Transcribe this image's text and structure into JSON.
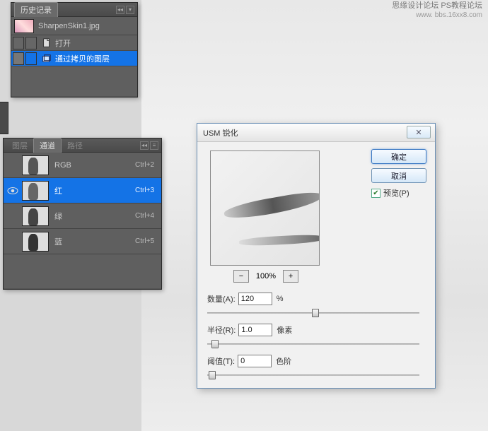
{
  "watermark": {
    "line1": "思缘设计论坛  PS教程论坛",
    "line2": "www.  bbs.16xx8.com"
  },
  "history": {
    "tab": "历史记录",
    "filename": "SharpenSkin1.jpg",
    "items": [
      {
        "icon": "open",
        "label": "打开"
      },
      {
        "icon": "layer",
        "label": "通过拷贝的图层",
        "selected": true
      }
    ]
  },
  "channels": {
    "tabs": [
      "图层",
      "通道",
      "路径"
    ],
    "active_tab": 1,
    "rows": [
      {
        "name": "RGB",
        "key": "Ctrl+2",
        "eye": false
      },
      {
        "name": "红",
        "key": "Ctrl+3",
        "eye": true,
        "selected": true
      },
      {
        "name": "绿",
        "key": "Ctrl+4",
        "eye": false
      },
      {
        "name": "蓝",
        "key": "Ctrl+5",
        "eye": false
      }
    ]
  },
  "dialog": {
    "title": "USM 锐化",
    "ok": "确定",
    "cancel": "取消",
    "preview_label": "预览(P)",
    "preview_checked": true,
    "zoom": "100%",
    "zoom_out_glyph": "−",
    "zoom_in_glyph": "+",
    "amount_label": "数量(A):",
    "amount_value": "120",
    "amount_unit": "%",
    "radius_label": "半径(R):",
    "radius_value": "1.0",
    "radius_unit": "像素",
    "threshold_label": "阈值(T):",
    "threshold_value": "0",
    "threshold_unit": "色阶",
    "close_glyph": "✕"
  }
}
